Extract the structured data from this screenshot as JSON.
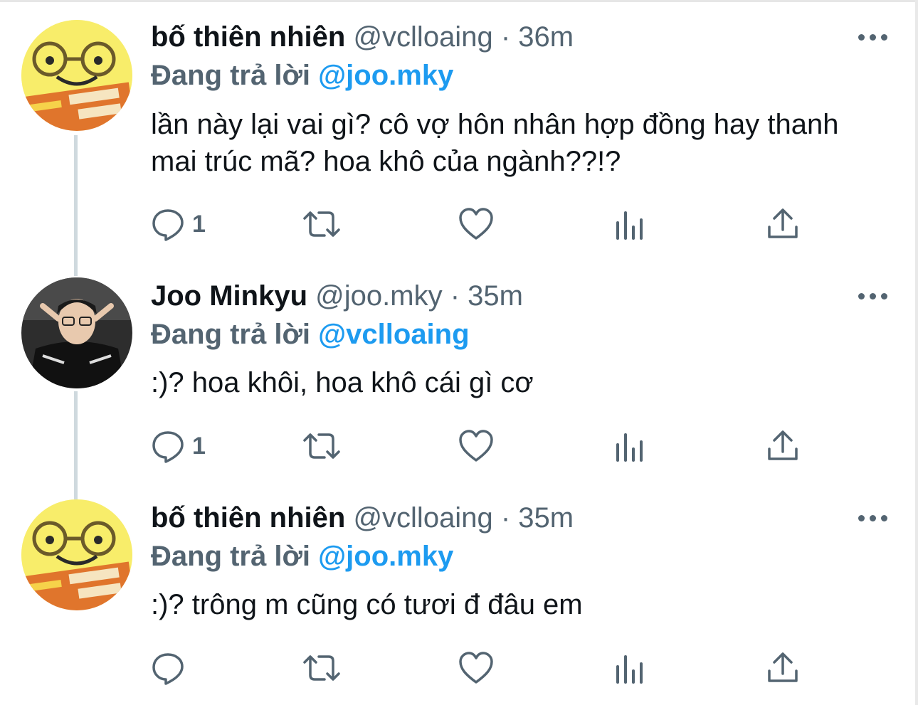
{
  "tweets": [
    {
      "name": "bố thiên nhiên",
      "handle": "@vclloaing",
      "time": "36m",
      "reply_label": "Đang trả lời",
      "reply_to": "@joo.mky",
      "text": "lần này lại vai gì? cô vợ hôn nhân hợp đồng hay thanh mai trúc mã? hoa khô của ngành??!?",
      "reply_count": "1",
      "avatar": "yellow-plush-glasses-avatar"
    },
    {
      "name": "Joo Minkyu",
      "handle": "@joo.mky",
      "time": "35m",
      "reply_label": "Đang trả lời",
      "reply_to": "@vclloaing",
      "text": ":)? hoa khôi, hoa khô cái gì cơ",
      "reply_count": "1",
      "avatar": "man-photo-avatar"
    },
    {
      "name": "bố thiên nhiên",
      "handle": "@vclloaing",
      "time": "35m",
      "reply_label": "Đang trả lời",
      "reply_to": "@joo.mky",
      "text": ":)? trông m cũng có tươi đ đâu em",
      "reply_count": "",
      "avatar": "yellow-plush-glasses-avatar"
    }
  ],
  "separator": "·",
  "icons": [
    "reply-icon",
    "retweet-icon",
    "like-icon",
    "analytics-icon",
    "share-icon",
    "more-icon"
  ],
  "colors": {
    "link": "#1d9bf0",
    "secondary": "#536471",
    "text": "#0f1419",
    "thread_line": "#cfd9de"
  }
}
